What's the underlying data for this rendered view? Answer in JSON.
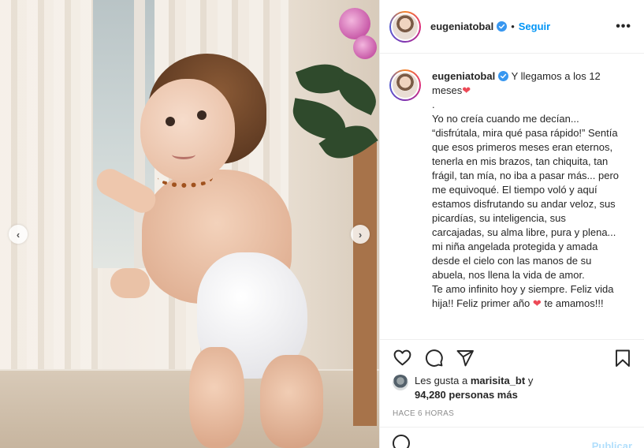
{
  "header": {
    "username": "eugeniatobal",
    "separator": "•",
    "follow_label": "Seguir",
    "more_label": "•••"
  },
  "caption": {
    "username": "eugeniatobal",
    "first_line": " Y llegamos a los 12 meses",
    "heart_1": "❤",
    "paragraphs": [
      ".",
      "Yo no creía cuando me decían... “disfrútala, mira qué pasa rápido!” Sentía que esos primeros meses eran eternos, tenerla en mis brazos, tan chiquita, tan frágil, tan mía, no iba a pasar más... pero me equivoqué. El tiempo voló y aquí estamos disfrutando su andar veloz, sus picardías, su inteligencia, sus carcajadas, su alma libre, pura y plena... mi niña angelada protegida y amada desde el cielo con las manos de su abuela, nos llena la vida de amor.",
      "Te amo infinito hoy y siempre. Feliz vida hija!! Feliz primer año",
      "te amamos!!!"
    ],
    "heart_2": "❤"
  },
  "likes": {
    "prefix": "Les gusta a ",
    "user": "marisita_bt",
    "connector": " y",
    "count": "94,280 personas más"
  },
  "timestamp": "HACE 6 HORAS",
  "comment": {
    "post_label": "Publicar"
  },
  "carousel": {
    "prev": "‹",
    "next": "›"
  },
  "colors": {
    "follow": "#0095f6",
    "heart": "#ed4956",
    "verified": "#3897f0"
  },
  "icons": [
    "heart-icon",
    "comment-icon",
    "share-icon",
    "bookmark-icon",
    "verified-icon",
    "emoji-icon"
  ]
}
